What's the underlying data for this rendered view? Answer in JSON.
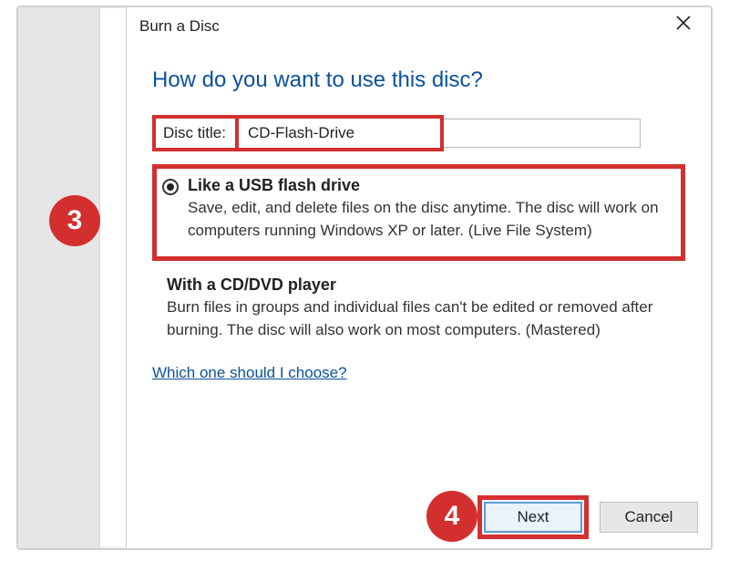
{
  "dialog": {
    "title": "Burn a Disc",
    "heading": "How do you want to use this disc?",
    "disc_title_label": "Disc title:",
    "disc_title_value": "CD-Flash-Drive",
    "options": [
      {
        "title": "Like a USB flash drive",
        "description": "Save, edit, and delete files on the disc anytime. The disc will work on computers running Windows XP or later. (Live File System)",
        "selected": true
      },
      {
        "title": "With a CD/DVD player",
        "description": "Burn files in groups and individual files can't be edited or removed after burning. The disc will also work on most computers. (Mastered)",
        "selected": false
      }
    ],
    "help_link": "Which one should I choose?",
    "buttons": {
      "next": "Next",
      "cancel": "Cancel"
    }
  },
  "annotations": {
    "badge3": "3",
    "badge4": "4"
  }
}
